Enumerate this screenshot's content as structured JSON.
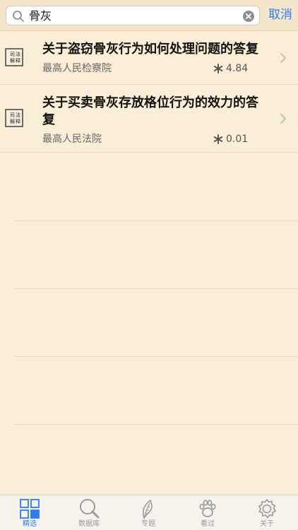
{
  "search": {
    "query": "骨灰",
    "cancel_label": "取消"
  },
  "results": [
    {
      "badge_text": "司法解释",
      "title": "关于盗窃骨灰行为如何处理问题的答复",
      "source": "最高人民检察院",
      "score": "4.84"
    },
    {
      "badge_text": "司法解释",
      "title": "关于买卖骨灰存放格位行为的效力的答复",
      "source": "最高人民法院",
      "score": "0.01"
    }
  ],
  "tabs": [
    {
      "label": "精选",
      "icon": "grid-icon",
      "active": true
    },
    {
      "label": "数据库",
      "icon": "magnifier-icon",
      "active": false
    },
    {
      "label": "专题",
      "icon": "leaf-icon",
      "active": false
    },
    {
      "label": "看过",
      "icon": "paw-icon",
      "active": false
    },
    {
      "label": "关于",
      "icon": "gear-icon",
      "active": false
    }
  ],
  "colors": {
    "background": "#fbeed7",
    "accent": "#2f7cf6",
    "inactive_tab": "#9a9a9a"
  }
}
